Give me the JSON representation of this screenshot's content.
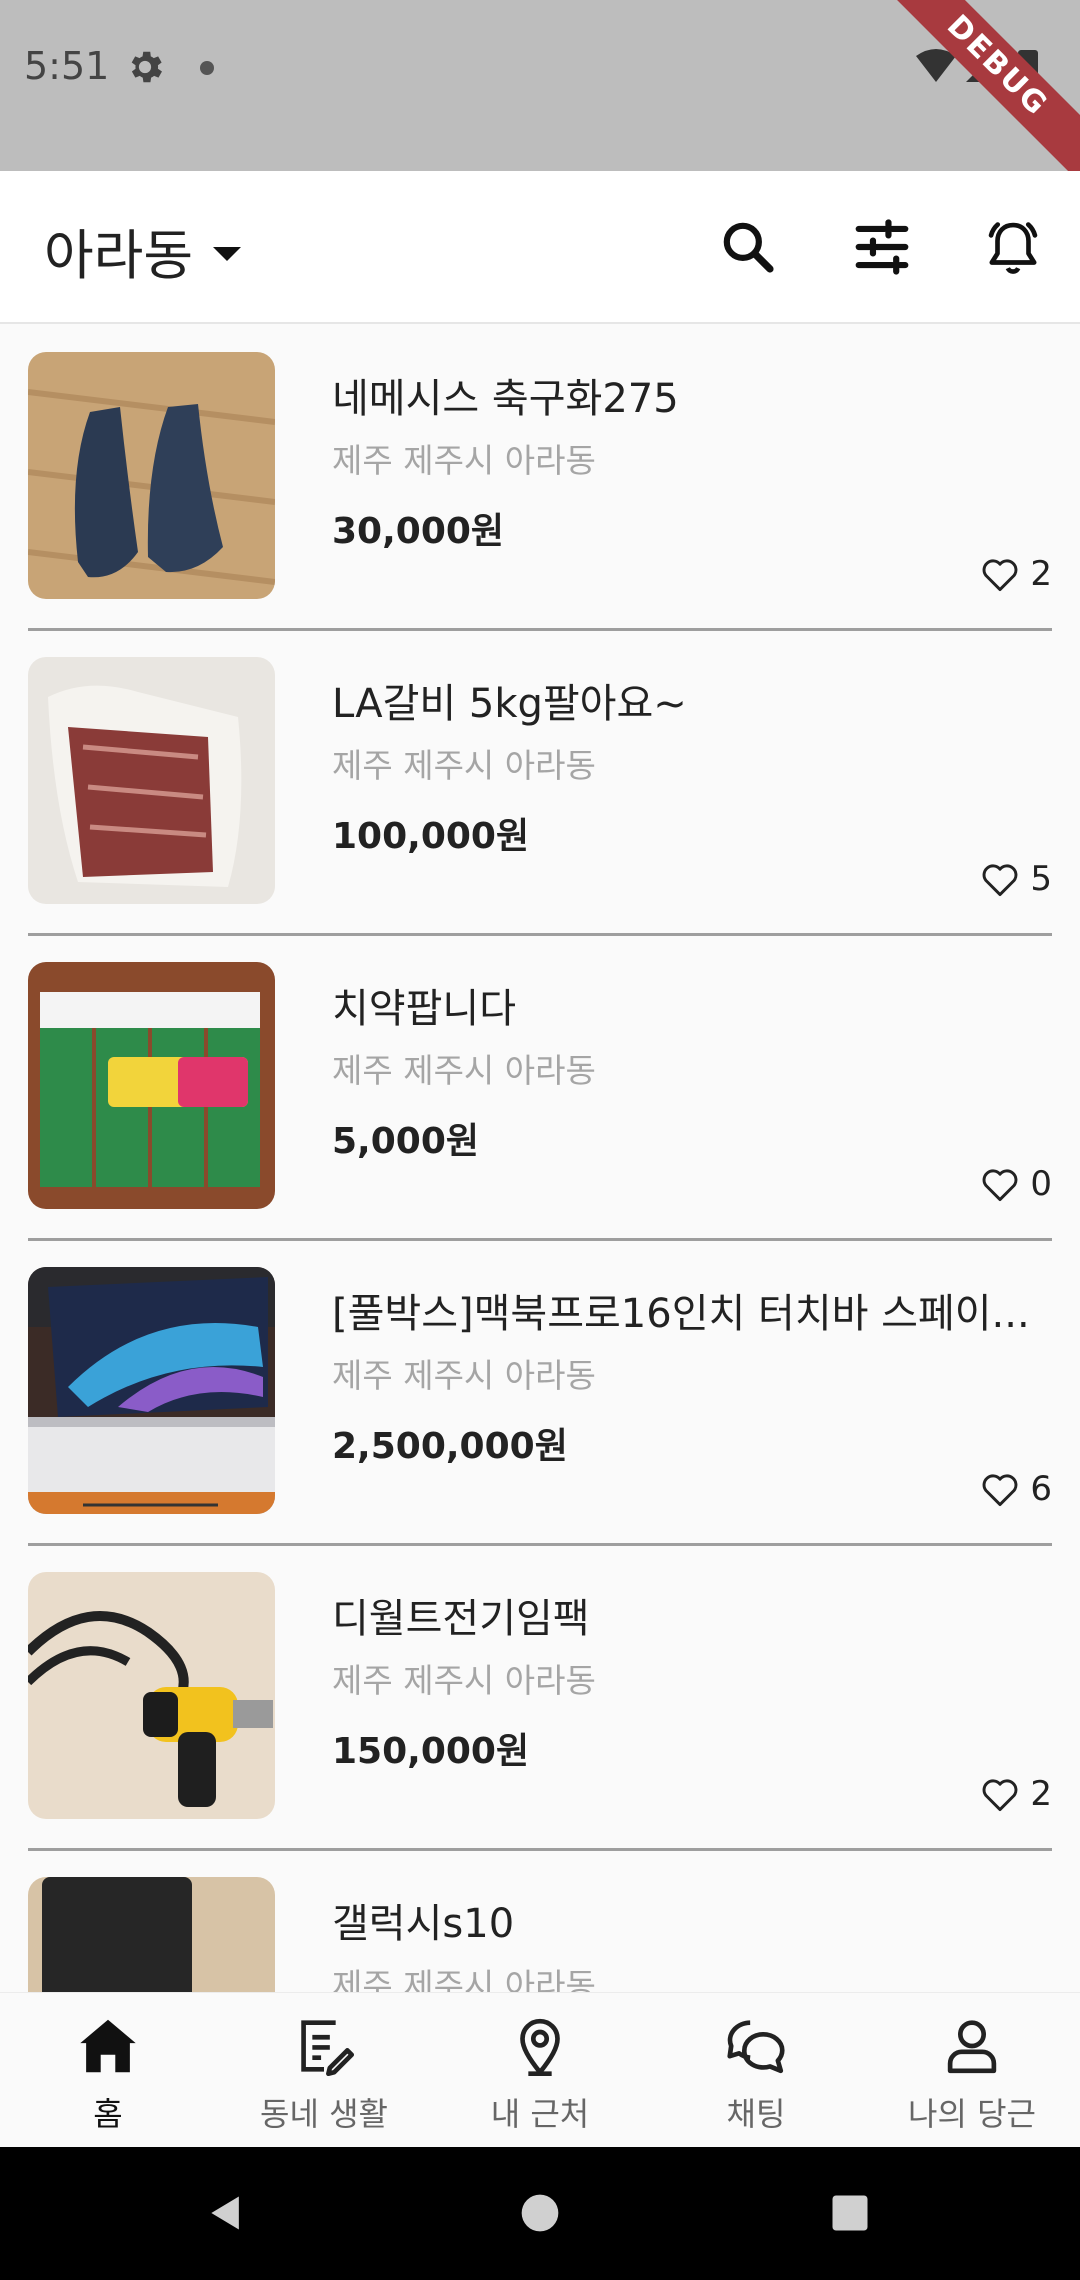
{
  "status_bar": {
    "time": "5:51",
    "debug_label": "DEBUG"
  },
  "app_bar": {
    "location": "아라동",
    "icons": [
      "search-icon",
      "filter-icon",
      "bell-icon"
    ]
  },
  "listings": [
    {
      "title": "네메시스 축구화275",
      "location": "제주 제주시 아라동",
      "price": "30,000원",
      "likes": "2",
      "thumbnail": "navy-soccer-shoes-photo"
    },
    {
      "title": "LA갈비 5kg팔아요~",
      "location": "제주 제주시 아라동",
      "price": "100,000원",
      "likes": "5",
      "thumbnail": "la-galbi-meat-photo"
    },
    {
      "title": "치약팝니다",
      "location": "제주 제주시 아라동",
      "price": "5,000원",
      "likes": "0",
      "thumbnail": "toothpaste-boxes-photo"
    },
    {
      "title": "[풀박스]맥북프로16인치 터치바 스페이...",
      "location": "제주 제주시 아라동",
      "price": "2,500,000원",
      "likes": "6",
      "thumbnail": "macbook-pro-box-photo"
    },
    {
      "title": "디월트전기임팩",
      "location": "제주 제주시 아라동",
      "price": "150,000원",
      "likes": "2",
      "thumbnail": "impact-drill-photo"
    },
    {
      "title": "갤럭시s10",
      "location": "제주 제주시 아라동",
      "price": "",
      "likes": "",
      "thumbnail": "galaxy-phone-photo"
    }
  ],
  "bottom_nav": [
    {
      "label": "홈",
      "icon": "home-icon",
      "active": true
    },
    {
      "label": "동네 생활",
      "icon": "note-edit-icon",
      "active": false
    },
    {
      "label": "내 근처",
      "icon": "location-pin-icon",
      "active": false
    },
    {
      "label": "채팅",
      "icon": "chat-bubbles-icon",
      "active": false
    },
    {
      "label": "나의 당근",
      "icon": "person-icon",
      "active": false
    }
  ],
  "colors": {
    "status_bar_bg": "#bdbdbd",
    "debug_ribbon": "#a83a3f",
    "divider": "#9e9e9e",
    "muted_text": "#a5a5a5"
  }
}
